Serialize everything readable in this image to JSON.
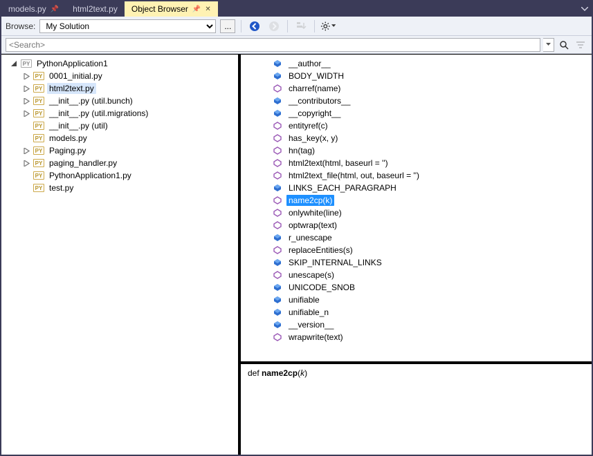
{
  "tabs": [
    {
      "label": "models.py",
      "active": false,
      "pinned": true
    },
    {
      "label": "html2text.py",
      "active": false,
      "pinned": false
    },
    {
      "label": "Object Browser",
      "active": true,
      "pinned": true
    }
  ],
  "toolbar": {
    "browse_label": "Browse:",
    "scope_options": [
      "My Solution"
    ],
    "scope_selected": "My Solution",
    "ellipsis": "..."
  },
  "search": {
    "value": "<Search>"
  },
  "tree": [
    {
      "depth": 0,
      "label": "PythonApplication1",
      "kind": "project",
      "expand": "open",
      "selected": false
    },
    {
      "depth": 1,
      "label": "0001_initial.py",
      "kind": "py",
      "expand": "closed",
      "selected": false
    },
    {
      "depth": 1,
      "label": "html2text.py",
      "kind": "py",
      "expand": "closed",
      "selected": true
    },
    {
      "depth": 1,
      "label": "__init__.py (util.bunch)",
      "kind": "py",
      "expand": "closed",
      "selected": false
    },
    {
      "depth": 1,
      "label": "__init__.py (util.migrations)",
      "kind": "py",
      "expand": "closed",
      "selected": false
    },
    {
      "depth": 1,
      "label": "__init__.py (util)",
      "kind": "py",
      "expand": "none",
      "selected": false
    },
    {
      "depth": 1,
      "label": "models.py",
      "kind": "py",
      "expand": "none",
      "selected": false
    },
    {
      "depth": 1,
      "label": "Paging.py",
      "kind": "py",
      "expand": "closed",
      "selected": false
    },
    {
      "depth": 1,
      "label": "paging_handler.py",
      "kind": "py",
      "expand": "closed",
      "selected": false
    },
    {
      "depth": 1,
      "label": "PythonApplication1.py",
      "kind": "py",
      "expand": "none",
      "selected": false
    },
    {
      "depth": 1,
      "label": "test.py",
      "kind": "py",
      "expand": "none",
      "selected": false
    }
  ],
  "members": [
    {
      "label": "__author__",
      "kind": "field",
      "selected": false
    },
    {
      "label": "BODY_WIDTH",
      "kind": "field",
      "selected": false
    },
    {
      "label": "charref(name)",
      "kind": "method",
      "selected": false
    },
    {
      "label": "__contributors__",
      "kind": "field",
      "selected": false
    },
    {
      "label": "__copyright__",
      "kind": "field",
      "selected": false
    },
    {
      "label": "entityref(c)",
      "kind": "method",
      "selected": false
    },
    {
      "label": "has_key(x, y)",
      "kind": "method",
      "selected": false
    },
    {
      "label": "hn(tag)",
      "kind": "method",
      "selected": false
    },
    {
      "label": "html2text(html, baseurl = '')",
      "kind": "method",
      "selected": false
    },
    {
      "label": "html2text_file(html, out, baseurl = '')",
      "kind": "method",
      "selected": false
    },
    {
      "label": "LINKS_EACH_PARAGRAPH",
      "kind": "field",
      "selected": false
    },
    {
      "label": "name2cp(k)",
      "kind": "method",
      "selected": true
    },
    {
      "label": "onlywhite(line)",
      "kind": "method",
      "selected": false
    },
    {
      "label": "optwrap(text)",
      "kind": "method",
      "selected": false
    },
    {
      "label": "r_unescape",
      "kind": "field",
      "selected": false
    },
    {
      "label": "replaceEntities(s)",
      "kind": "method",
      "selected": false
    },
    {
      "label": "SKIP_INTERNAL_LINKS",
      "kind": "field",
      "selected": false
    },
    {
      "label": "unescape(s)",
      "kind": "method",
      "selected": false
    },
    {
      "label": "UNICODE_SNOB",
      "kind": "field",
      "selected": false
    },
    {
      "label": "unifiable",
      "kind": "field",
      "selected": false
    },
    {
      "label": "unifiable_n",
      "kind": "field",
      "selected": false
    },
    {
      "label": "__version__",
      "kind": "field",
      "selected": false
    },
    {
      "label": "wrapwrite(text)",
      "kind": "method",
      "selected": false
    }
  ],
  "detail": {
    "keyword": "def",
    "name": "name2cp",
    "params": "k"
  },
  "colors": {
    "accent": "#1e90ff",
    "tab_active": "#fff2b3",
    "window_chrome": "#3b3b58"
  }
}
